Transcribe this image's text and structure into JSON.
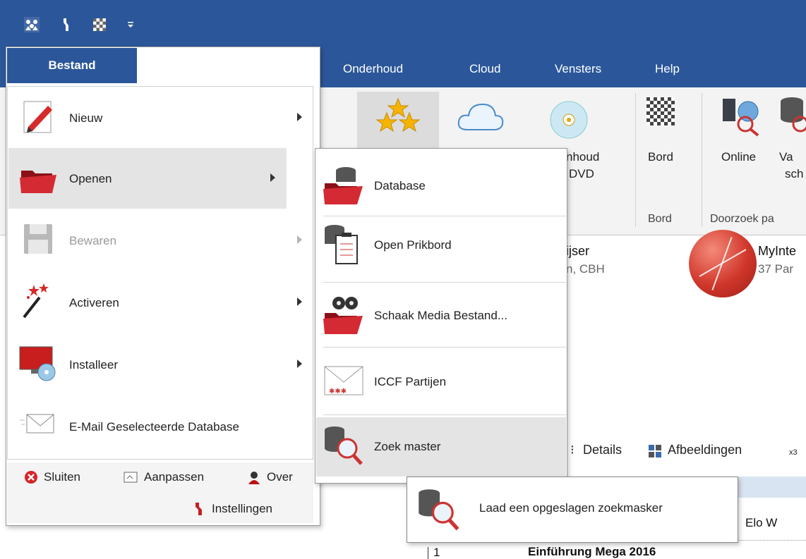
{
  "quick_access": {
    "icons": [
      "players-icon",
      "wrench-icon",
      "chessboard-icon",
      "customize-icon"
    ]
  },
  "menubar": {
    "tabs": [
      {
        "label": "Bestand"
      },
      {
        "label": "Onderhoud"
      },
      {
        "label": "Cloud"
      },
      {
        "label": "Vensters"
      },
      {
        "label": "Help"
      }
    ]
  },
  "ribbon": {
    "buttons": [
      {
        "line1": "nhoud",
        "line2": "DVD"
      },
      {
        "line1": "Bord",
        "line2": ""
      },
      {
        "line1": "Online",
        "line2": ""
      },
      {
        "line1": "Va",
        "line2": "sch"
      }
    ],
    "groups": [
      "Bord",
      "Doorzoek pa"
    ]
  },
  "content": {
    "db1_name": "ijser",
    "db1_sub": "n, CBH",
    "db2_name": "MyInte",
    "db2_sub": "37 Par",
    "view_details": "Details",
    "view_images": "Afbeeldingen",
    "view_zoom": "x3",
    "col_elo": "Elo W",
    "row_num": "1",
    "row_title": "Einführung Mega 2016"
  },
  "file_menu": {
    "tab_label": "Bestand",
    "items": [
      {
        "label": "Nieuw",
        "disabled": false
      },
      {
        "label": "Openen",
        "disabled": false
      },
      {
        "label": "Bewaren",
        "disabled": true
      },
      {
        "label": "Activeren",
        "disabled": false
      },
      {
        "label": "Installeer",
        "disabled": false
      },
      {
        "label": "E-Mail Geselecteerde Database",
        "disabled": false
      }
    ],
    "footer": {
      "close": "Sluiten",
      "customize": "Aanpassen",
      "about": "Over",
      "settings": "Instellingen"
    }
  },
  "open_submenu": {
    "items": [
      {
        "label": "Database"
      },
      {
        "label": "Open Prikbord"
      },
      {
        "label": "Schaak Media Bestand..."
      },
      {
        "label": "ICCF Partijen"
      },
      {
        "label": "Zoek master"
      }
    ]
  },
  "tooltip": {
    "text": "Laad een opgeslagen zoekmasker"
  },
  "colors": {
    "accent": "#2b579a",
    "hover": "#e4e4e4",
    "folder_red": "#c8232c"
  }
}
